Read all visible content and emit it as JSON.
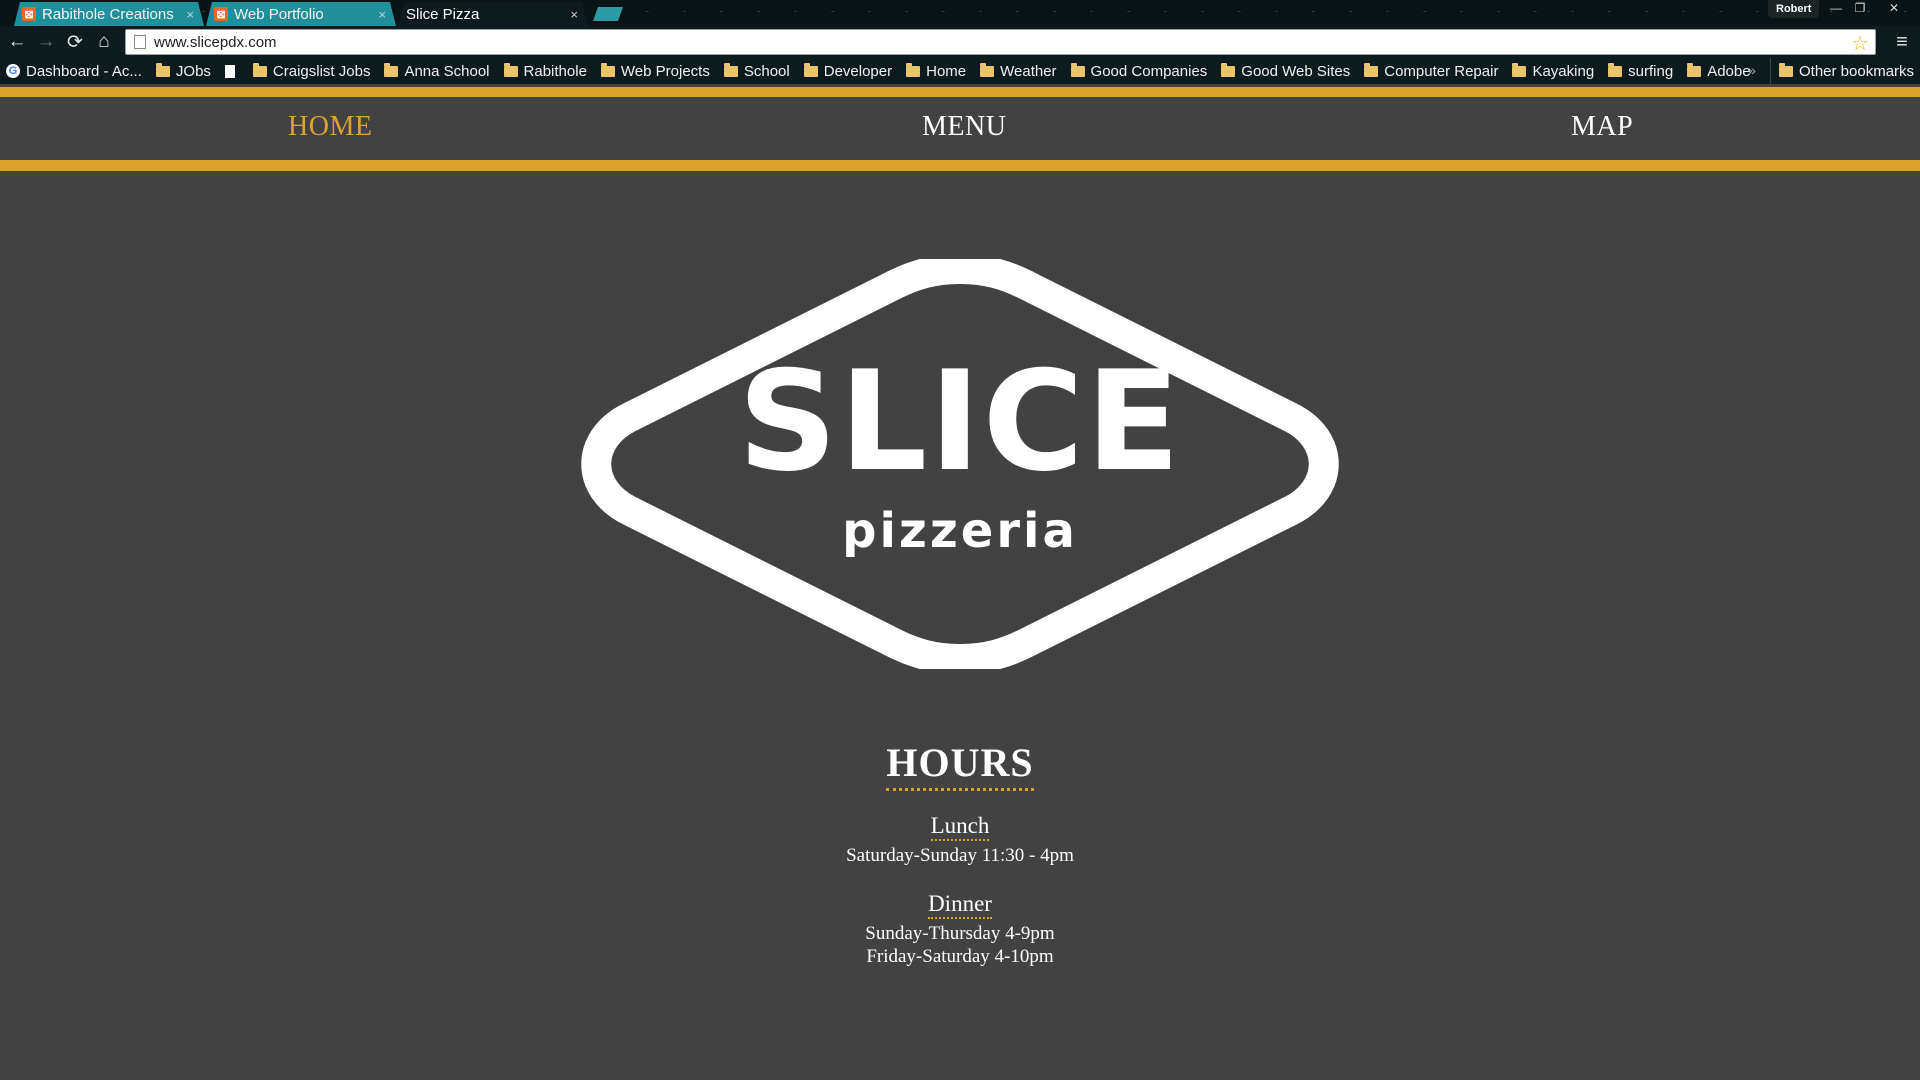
{
  "browser": {
    "tabs": [
      {
        "title": "Rabithole Creations",
        "state": "inactive",
        "favicon": "orange-square-icon",
        "close": "×"
      },
      {
        "title": "Web Portfolio",
        "state": "inactive",
        "favicon": "orange-square-icon",
        "close": "×"
      },
      {
        "title": "Slice Pizza",
        "state": "active",
        "favicon": "page-icon",
        "close": "×"
      }
    ],
    "profile_name": "Robert",
    "window_controls": {
      "minimize": "—",
      "restore": "❐",
      "close": "✕"
    },
    "nav": {
      "back": "←",
      "forward": "→",
      "reload": "⟳",
      "home": "⌂",
      "menu": "≡"
    },
    "url": "www.slicepdx.com",
    "star": "☆",
    "bookmarks": [
      {
        "label": "Dashboard - Ac...",
        "icon": "google-icon"
      },
      {
        "label": "JObs",
        "icon": "folder-icon"
      },
      {
        "label": "",
        "icon": "page-icon"
      },
      {
        "label": "Craigslist Jobs",
        "icon": "folder-icon"
      },
      {
        "label": "Anna School",
        "icon": "folder-icon"
      },
      {
        "label": "Rabithole",
        "icon": "folder-icon"
      },
      {
        "label": "Web Projects",
        "icon": "folder-icon"
      },
      {
        "label": "School",
        "icon": "folder-icon"
      },
      {
        "label": "Developer",
        "icon": "folder-icon"
      },
      {
        "label": "Home",
        "icon": "folder-icon"
      },
      {
        "label": "Weather",
        "icon": "folder-icon"
      },
      {
        "label": "Good Companies",
        "icon": "folder-icon"
      },
      {
        "label": "Good Web Sites",
        "icon": "folder-icon"
      },
      {
        "label": "Computer Repair",
        "icon": "folder-icon"
      },
      {
        "label": "Kayaking",
        "icon": "folder-icon"
      },
      {
        "label": "surfing",
        "icon": "folder-icon"
      },
      {
        "label": "Adobe",
        "icon": "folder-icon"
      }
    ],
    "bookmarks_overflow": "»",
    "other_bookmarks": "Other bookmarks"
  },
  "site": {
    "nav": [
      {
        "label": "HOME",
        "current": true
      },
      {
        "label": "MENU",
        "current": false
      },
      {
        "label": "MAP",
        "current": false
      }
    ],
    "logo": {
      "brand": "SLICE",
      "sub": "pizzeria"
    },
    "hours": {
      "title": "HOURS",
      "lunch": {
        "title": "Lunch",
        "lines": [
          "Saturday-Sunday 11:30 - 4pm"
        ]
      },
      "dinner": {
        "title": "Dinner",
        "lines": [
          "Sunday-Thursday 4-9pm",
          "Friday-Saturday 4-10pm"
        ]
      }
    }
  },
  "colors": {
    "page_bg": "#424242",
    "accent_gold": "#d7a12a",
    "chrome_bg": "#0e1b1e",
    "tab_inactive": "#1f8f9c"
  }
}
